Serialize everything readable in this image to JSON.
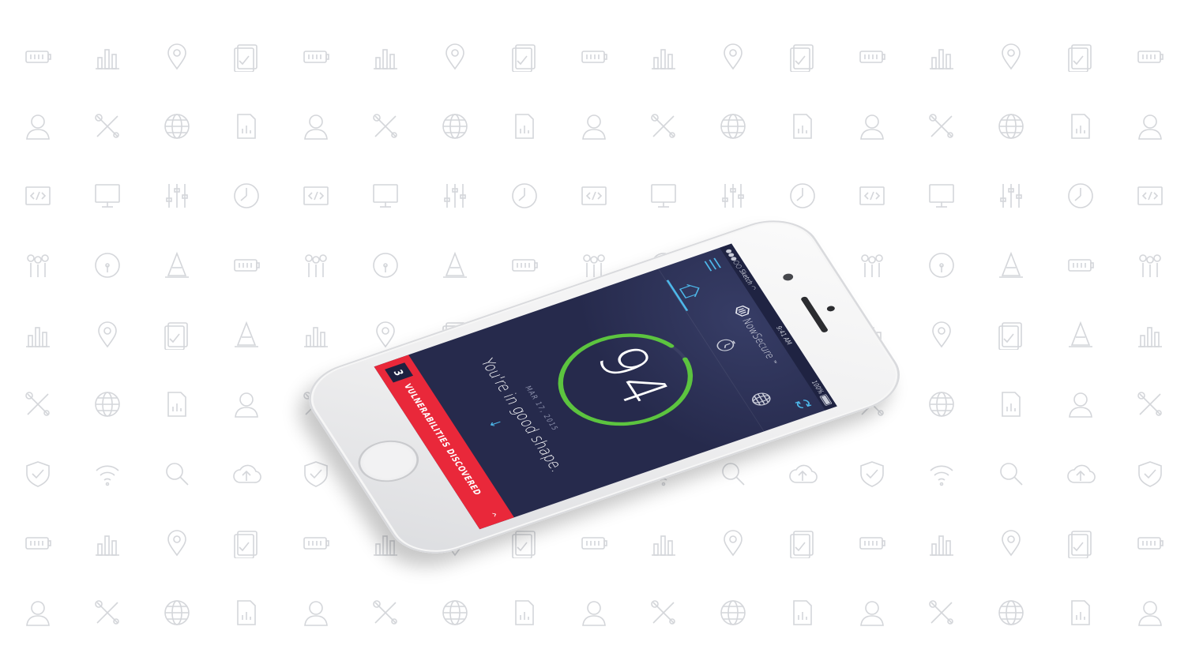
{
  "colors": {
    "screen_bg": "#262a4c",
    "accent_blue": "#4db8ea",
    "score_ring_green": "#5cc43f",
    "alert_red": "#e9283a",
    "alert_count_bg": "#1e2140",
    "pattern_gray": "#d4d6da"
  },
  "status_bar": {
    "carrier": "●●●○○ Sketch",
    "time": "9:41 AM",
    "battery": "100%"
  },
  "nav": {
    "brand": "NowSecure",
    "brand_tm": "™"
  },
  "tabs": {
    "active": "home"
  },
  "score": {
    "value": "94",
    "ring_fill": 0.94
  },
  "scan": {
    "date": "MAR 17, 2015",
    "message": "You're in good shape."
  },
  "alert": {
    "count": "3",
    "label": "VULNERABILITIES DISCOVERED"
  },
  "background_icons": [
    "battery-icon",
    "bar-chart-icon",
    "location-pin-icon",
    "tablet-check-icon",
    "battery-icon",
    "bar-chart-icon",
    "location-pin-icon",
    "tablet-check-icon",
    "battery-icon",
    "bar-chart-icon",
    "location-pin-icon",
    "tablet-check-icon",
    "battery-icon",
    "bar-chart-icon",
    "location-pin-icon",
    "tablet-check-icon",
    "battery-icon",
    "user-icon",
    "tools-icon",
    "globe-icon",
    "document-chart-icon",
    "user-icon",
    "tools-icon",
    "globe-icon",
    "document-chart-icon",
    "user-icon",
    "tools-icon",
    "globe-icon",
    "document-chart-icon",
    "user-icon",
    "tools-icon",
    "globe-icon",
    "document-chart-icon",
    "user-icon",
    "code-file-icon",
    "monitor-icon",
    "sliders-icon",
    "clock-icon",
    "code-file-icon",
    "monitor-icon",
    "sliders-icon",
    "clock-icon",
    "code-file-icon",
    "monitor-icon",
    "sliders-icon",
    "clock-icon",
    "code-file-icon",
    "monitor-icon",
    "sliders-icon",
    "clock-icon",
    "code-file-icon",
    "people-icon",
    "gauge-icon",
    "cone-icon",
    "battery-icon",
    "people-icon",
    "gauge-icon",
    "cone-icon",
    "battery-icon",
    "people-icon",
    "gauge-icon",
    "cone-icon",
    "battery-icon",
    "people-icon",
    "gauge-icon",
    "cone-icon",
    "battery-icon",
    "people-icon",
    "bar-chart-icon",
    "location-pin-icon",
    "tablet-check-icon",
    "cone-icon",
    "bar-chart-icon",
    "location-pin-icon",
    "tablet-check-icon",
    "cone-icon",
    "bar-chart-icon",
    "location-pin-icon",
    "tablet-check-icon",
    "cone-icon",
    "bar-chart-icon",
    "location-pin-icon",
    "tablet-check-icon",
    "cone-icon",
    "bar-chart-icon",
    "tools-icon",
    "globe-icon",
    "document-chart-icon",
    "user-icon",
    "tools-icon",
    "globe-icon",
    "document-chart-icon",
    "user-icon",
    "tools-icon",
    "globe-icon",
    "document-chart-icon",
    "user-icon",
    "tools-icon",
    "globe-icon",
    "document-chart-icon",
    "user-icon",
    "tools-icon",
    "shield-icon",
    "wifi-icon",
    "search-icon",
    "cloud-upload-icon",
    "shield-icon",
    "wifi-icon",
    "search-icon",
    "cloud-upload-icon",
    "shield-icon",
    "wifi-icon",
    "search-icon",
    "cloud-upload-icon",
    "shield-icon",
    "wifi-icon",
    "search-icon",
    "cloud-upload-icon",
    "shield-icon",
    "battery-icon",
    "bar-chart-icon",
    "location-pin-icon",
    "tablet-check-icon",
    "battery-icon",
    "bar-chart-icon",
    "location-pin-icon",
    "tablet-check-icon",
    "battery-icon",
    "bar-chart-icon",
    "location-pin-icon",
    "tablet-check-icon",
    "battery-icon",
    "bar-chart-icon",
    "location-pin-icon",
    "tablet-check-icon",
    "battery-icon",
    "user-icon",
    "tools-icon",
    "globe-icon",
    "document-chart-icon",
    "user-icon",
    "tools-icon",
    "globe-icon",
    "document-chart-icon",
    "user-icon",
    "tools-icon",
    "globe-icon",
    "document-chart-icon",
    "user-icon",
    "tools-icon",
    "globe-icon",
    "document-chart-icon",
    "user-icon"
  ]
}
